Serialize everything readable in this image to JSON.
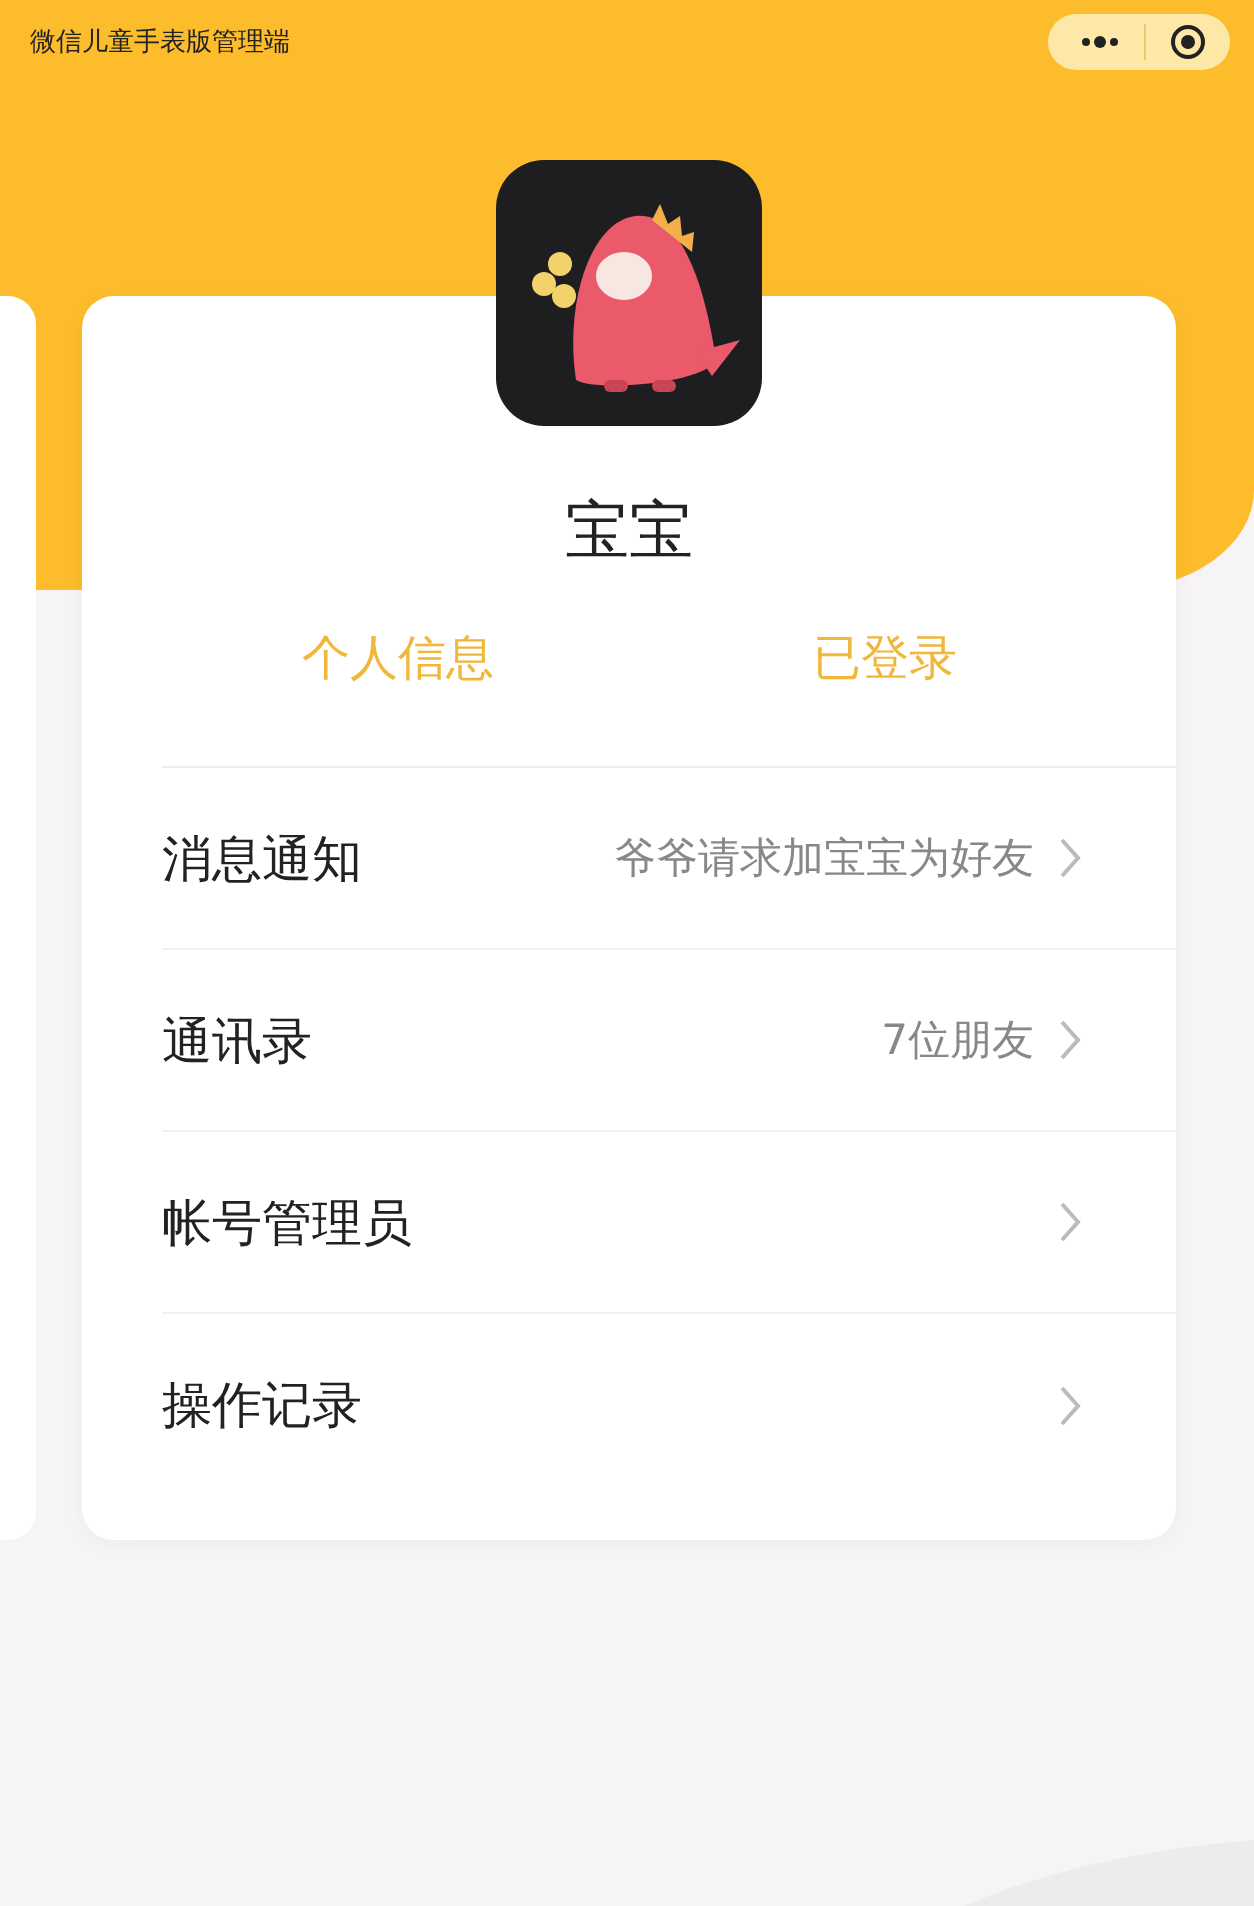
{
  "status_bar": {
    "title": "微信儿童手表版管理端"
  },
  "profile": {
    "name": "宝宝"
  },
  "actions": [
    {
      "label": "个人信息"
    },
    {
      "label": "已登录"
    }
  ],
  "menu": [
    {
      "label": "消息通知",
      "value": "爷爷请求加宝宝为好友"
    },
    {
      "label": "通讯录",
      "value": "7位朋友"
    },
    {
      "label": "帐号管理员"
    },
    {
      "label": "操作记录"
    }
  ]
}
